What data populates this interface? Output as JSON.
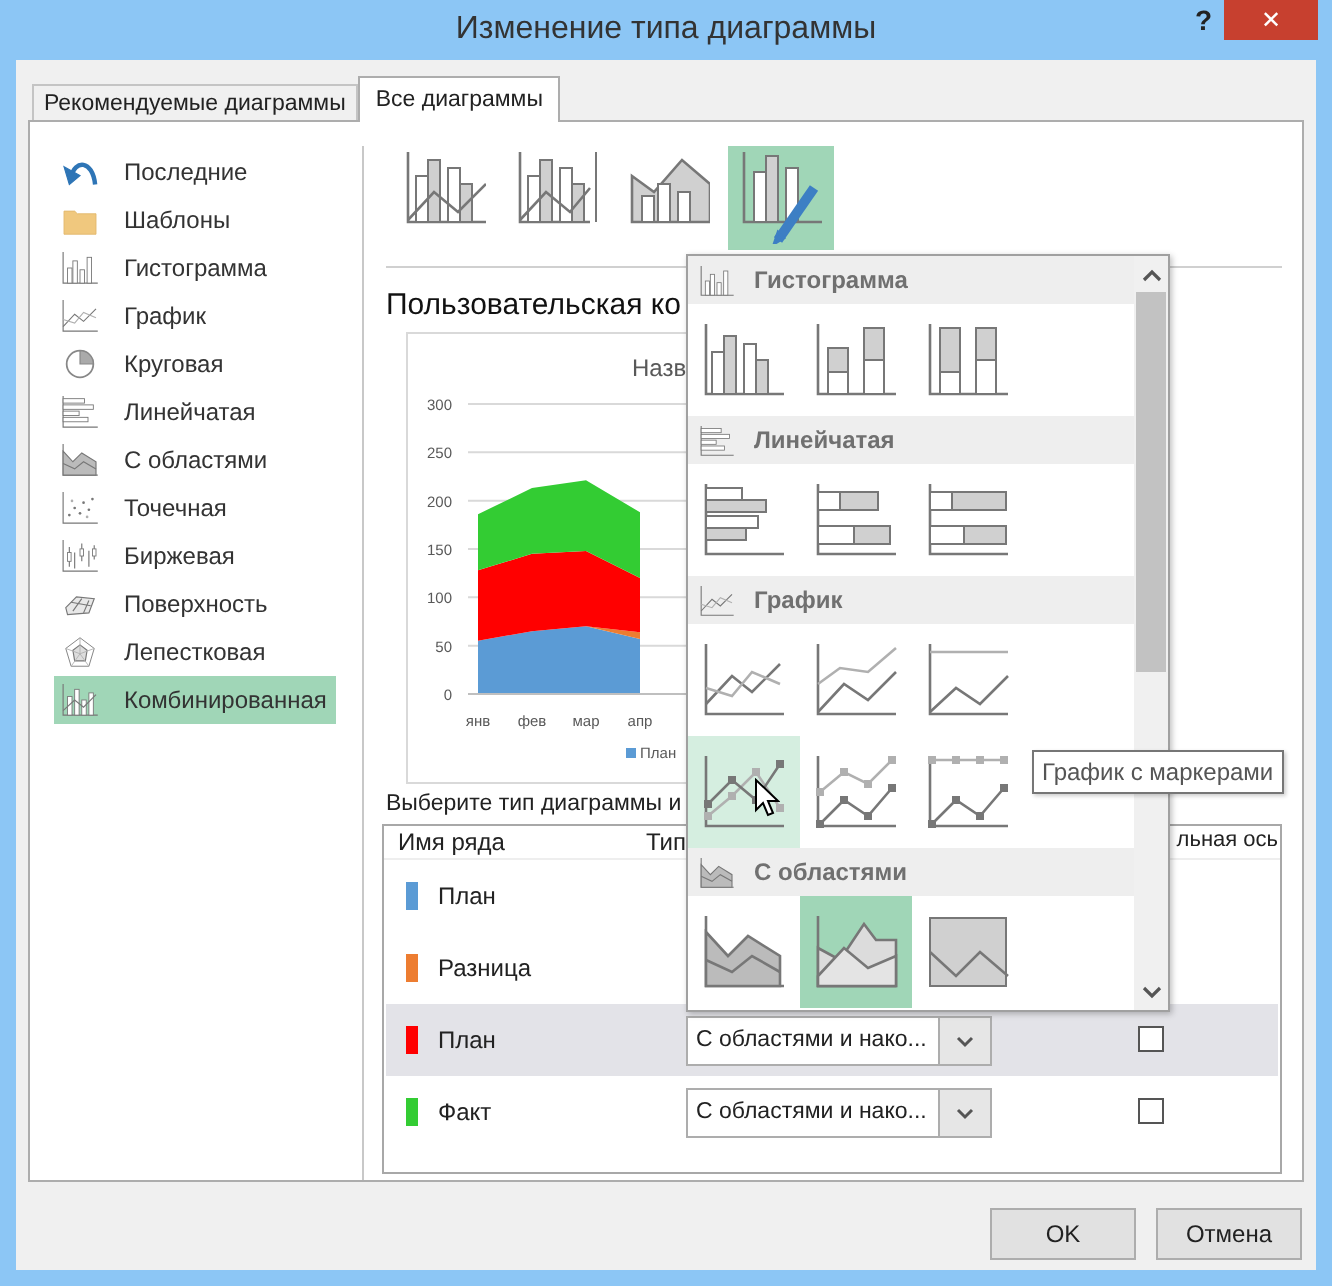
{
  "window": {
    "title": "Изменение типа диаграммы",
    "help": "?",
    "close": "✕"
  },
  "tabs": [
    {
      "label": "Рекомендуемые диаграммы",
      "selected": false
    },
    {
      "label": "Все диаграммы",
      "selected": true
    }
  ],
  "sidebar": {
    "items": [
      {
        "label": "Последние",
        "kind": "recent",
        "selected": false
      },
      {
        "label": "Шаблоны",
        "kind": "templates",
        "selected": false
      },
      {
        "label": "Гистограмма",
        "kind": "column",
        "selected": false
      },
      {
        "label": "График",
        "kind": "line",
        "selected": false
      },
      {
        "label": "Круговая",
        "kind": "pie",
        "selected": false
      },
      {
        "label": "Линейчатая",
        "kind": "bar",
        "selected": false
      },
      {
        "label": "С областями",
        "kind": "area",
        "selected": false
      },
      {
        "label": "Точечная",
        "kind": "scatter",
        "selected": false
      },
      {
        "label": "Биржевая",
        "kind": "stock",
        "selected": false
      },
      {
        "label": "Поверхность",
        "kind": "surface",
        "selected": false
      },
      {
        "label": "Лепестковая",
        "kind": "radar",
        "selected": false
      },
      {
        "label": "Комбинированная",
        "kind": "combo",
        "selected": true
      }
    ]
  },
  "combo_types": [
    {
      "kind": "column-line",
      "selected": false
    },
    {
      "kind": "column-line-secondary",
      "selected": false
    },
    {
      "kind": "area-column",
      "selected": false
    },
    {
      "kind": "custom",
      "selected": true
    }
  ],
  "heading": "Пользовательская ко",
  "chart": {
    "chart_data": {
      "type": "area",
      "stacked": true,
      "grid": true,
      "title": "Назв",
      "categories": [
        "янв",
        "фев",
        "мар",
        "апр"
      ],
      "yticks": [
        0,
        50,
        100,
        150,
        200,
        250,
        300
      ],
      "ylim": [
        0,
        300
      ],
      "series": [
        {
          "name": "План",
          "color": "#5b9bd5",
          "values": [
            55,
            65,
            70,
            57
          ]
        },
        {
          "color": "#ed7d31",
          "values": [
            0,
            0,
            0,
            7
          ]
        },
        {
          "color": "#ff0000",
          "values": [
            73,
            80,
            78,
            56
          ]
        },
        {
          "color": "#33cc33",
          "values": [
            58,
            68,
            73,
            68
          ]
        }
      ]
    }
  },
  "series_prompt": "Выберите тип диаграммы и",
  "series_table": {
    "columns": [
      "Имя ряда",
      "Тип",
      "льная ось"
    ],
    "rows": [
      {
        "name": "План",
        "color": "#5b9bd5",
        "selected": false
      },
      {
        "name": "Разница",
        "color": "#ed7d31",
        "selected": false
      },
      {
        "name": "План",
        "color": "#ff0000",
        "selected": true,
        "type": "С областями и нако...",
        "secondary_axis": false
      },
      {
        "name": "Факт",
        "color": "#33cc33",
        "selected": false,
        "type": "С областями и нако...",
        "secondary_axis": false
      }
    ]
  },
  "type_gallery": {
    "sections": [
      {
        "title": "Гистограмма",
        "kind": "column",
        "items": [
          {
            "kind": "column-clustered",
            "selected": false,
            "hovered": false
          },
          {
            "kind": "column-stacked",
            "selected": false,
            "hovered": false
          },
          {
            "kind": "column-100",
            "selected": false,
            "hovered": false
          }
        ]
      },
      {
        "title": "Линейчатая",
        "kind": "bar",
        "items": [
          {
            "kind": "bar-clustered",
            "selected": false,
            "hovered": false
          },
          {
            "kind": "bar-stacked",
            "selected": false,
            "hovered": false
          },
          {
            "kind": "bar-100",
            "selected": false,
            "hovered": false
          }
        ]
      },
      {
        "title": "График",
        "kind": "line",
        "items": [
          {
            "kind": "line",
            "selected": false,
            "hovered": false
          },
          {
            "kind": "line-stacked",
            "selected": false,
            "hovered": false
          },
          {
            "kind": "line-100",
            "selected": false,
            "hovered": false
          },
          {
            "kind": "line-markers",
            "selected": false,
            "hovered": true
          },
          {
            "kind": "line-stacked-markers",
            "selected": false,
            "hovered": false
          },
          {
            "kind": "line-100-markers",
            "selected": false,
            "hovered": false
          }
        ]
      },
      {
        "title": "С областями",
        "kind": "area",
        "items": [
          {
            "kind": "area",
            "selected": false,
            "hovered": false
          },
          {
            "kind": "area-stacked",
            "selected": true,
            "hovered": false
          },
          {
            "kind": "area-100",
            "selected": false,
            "hovered": false
          }
        ]
      }
    ],
    "tooltip": "График с маркерами"
  },
  "buttons": [
    {
      "label": "OK"
    },
    {
      "label": "Отмена"
    }
  ]
}
